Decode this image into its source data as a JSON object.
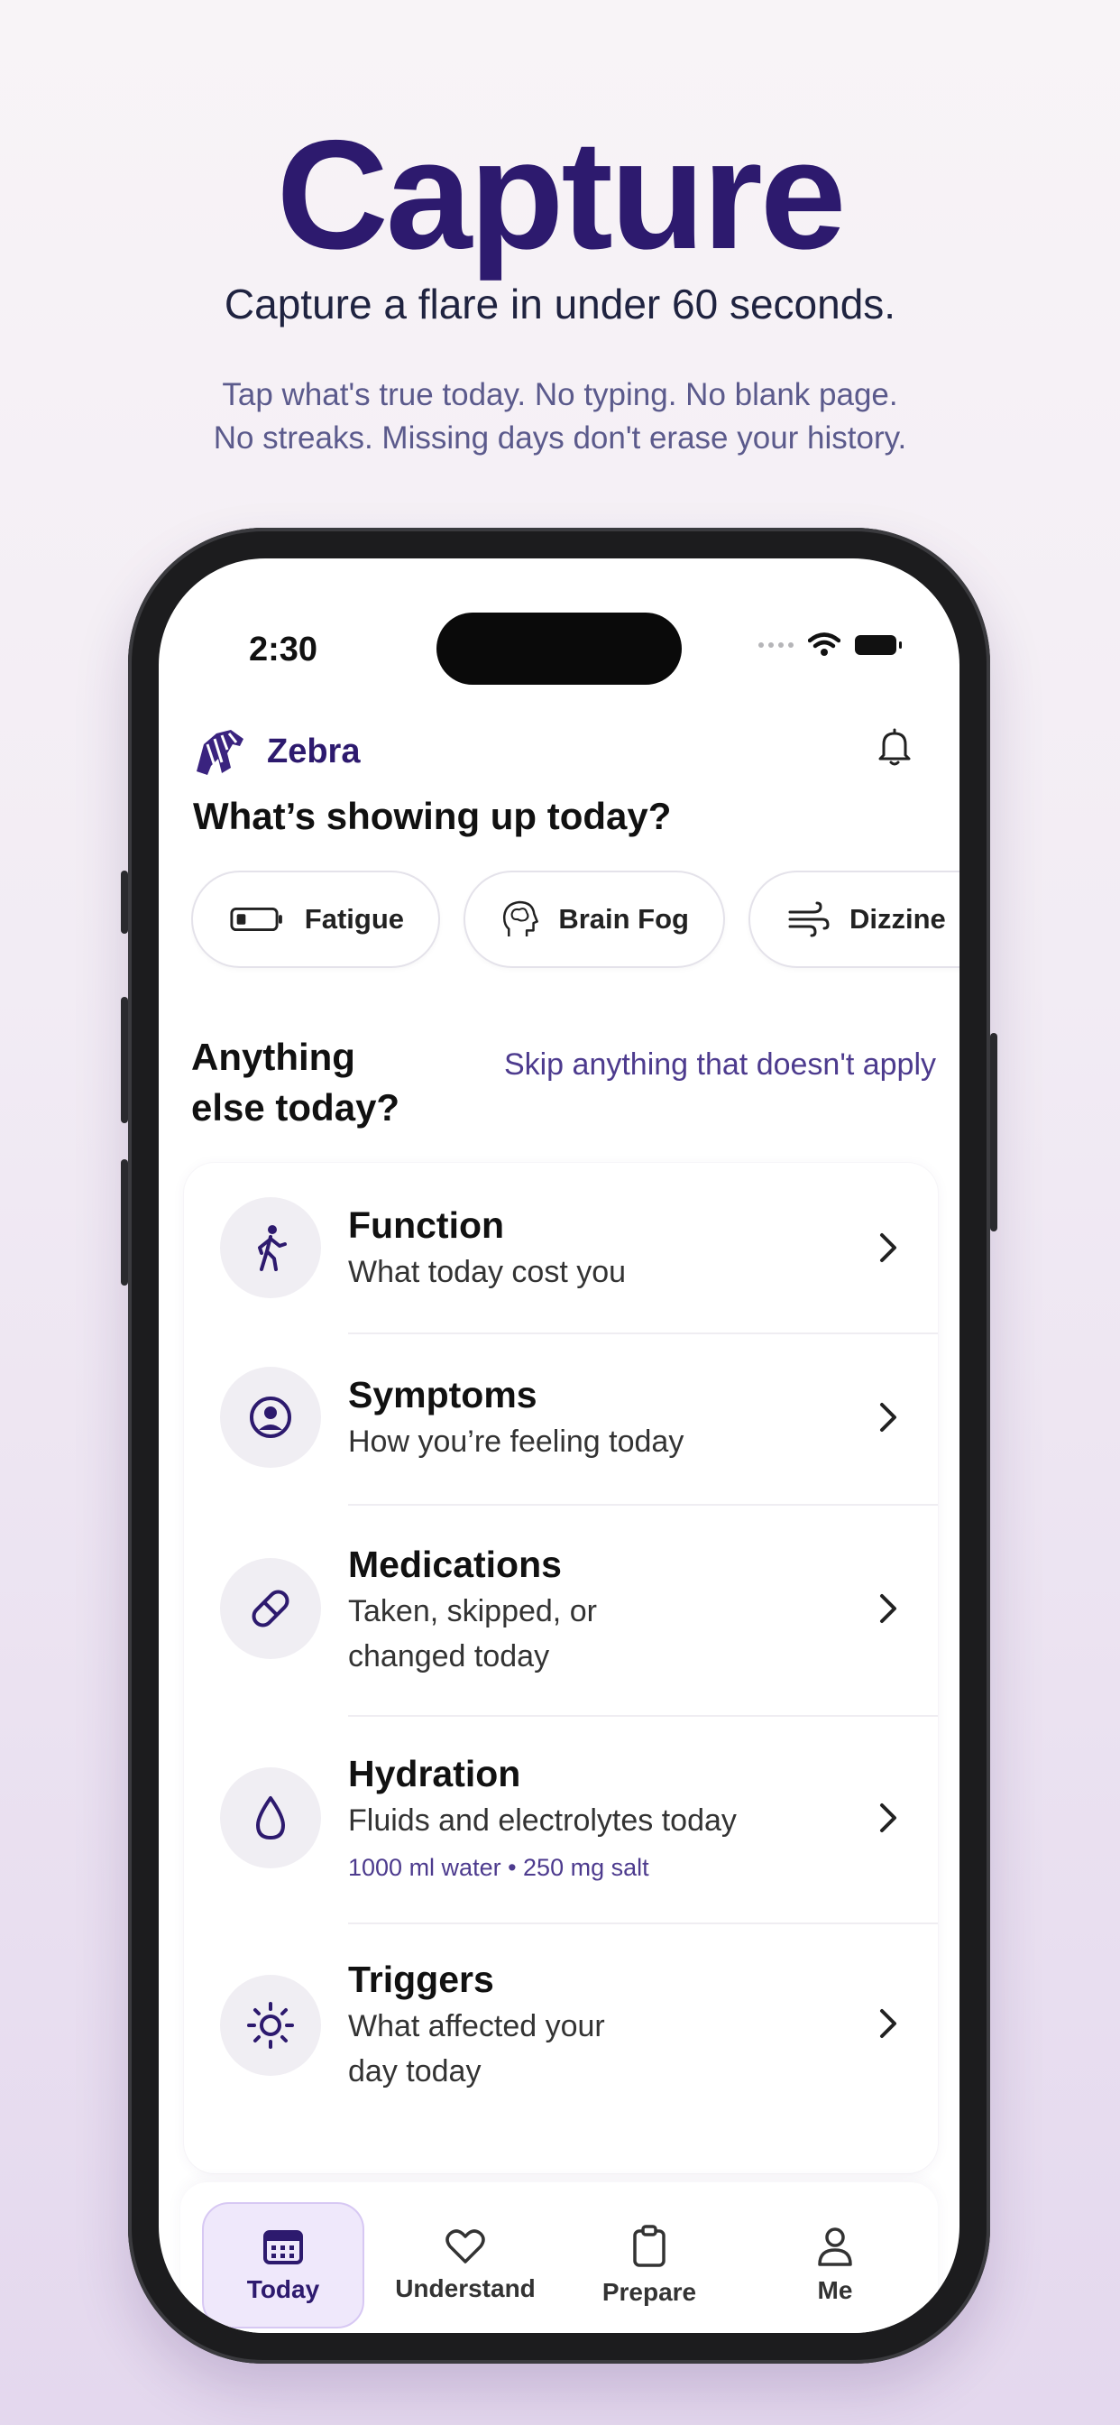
{
  "hero": {
    "title": "Capture",
    "subtitle": "Capture a flare in under 60 seconds.",
    "tagline_line1": "Tap what's true today. No typing. No blank page.",
    "tagline_line2": "No streaks. Missing days don't erase your history."
  },
  "status_bar": {
    "time": "2:30"
  },
  "app": {
    "brand_name": "Zebra",
    "brand_icon": "zebra-icon",
    "notification_icon": "bell-icon",
    "colors": {
      "accent": "#2d1a6e",
      "link": "#4d3b8e",
      "tab_active_bg": "#efe8fb"
    }
  },
  "today": {
    "heading": "What’s showing up today?",
    "chips": [
      {
        "label": "Fatigue",
        "icon": "low-battery-icon"
      },
      {
        "label": "Brain Fog",
        "icon": "brain-head-icon"
      },
      {
        "label": "Dizzine",
        "icon": "wind-icon"
      }
    ]
  },
  "else_section": {
    "heading_line1": "Anything",
    "heading_line2": "else today?",
    "skip_text": "Skip anything that doesn't apply"
  },
  "categories": [
    {
      "title": "Function",
      "subtitle": "What today cost you",
      "icon": "walking-person-icon"
    },
    {
      "title": "Symptoms",
      "subtitle": "How you’re feeling today",
      "icon": "person-circle-icon"
    },
    {
      "title": "Medications",
      "subtitle_line1": "Taken, skipped, or",
      "subtitle_line2": "changed today",
      "icon": "pill-icon"
    },
    {
      "title": "Hydration",
      "subtitle": "Fluids and electrolytes today",
      "meta": "1000 ml water • 250 mg salt",
      "icon": "droplet-icon"
    },
    {
      "title": "Triggers",
      "subtitle_line1": "What affected your",
      "subtitle_line2": "day today",
      "icon": "sun-icon"
    }
  ],
  "tabs": [
    {
      "label": "Today",
      "icon": "calendar-icon",
      "active": true
    },
    {
      "label": "Understand",
      "icon": "heart-icon"
    },
    {
      "label": "Prepare",
      "icon": "clipboard-icon"
    },
    {
      "label": "Me",
      "icon": "person-icon"
    }
  ]
}
